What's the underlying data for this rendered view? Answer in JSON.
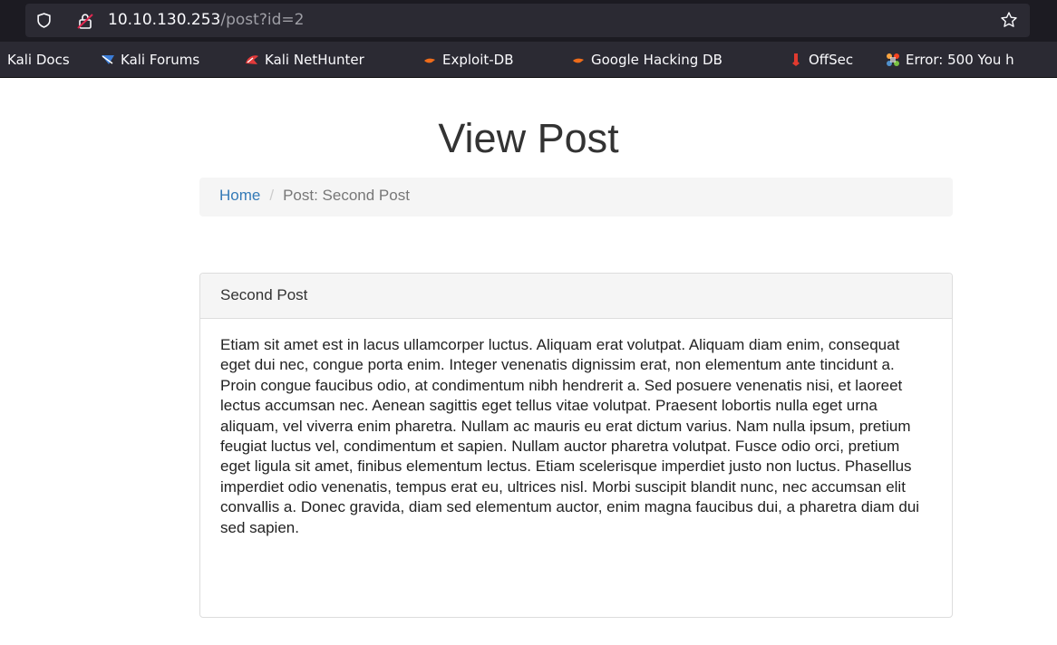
{
  "browser": {
    "url_host": "10.10.130.253",
    "url_path": "/post?id=2",
    "bookmarks": [
      {
        "label": "Kali Docs",
        "icon": "kali-docs-icon"
      },
      {
        "label": "Kali Forums",
        "icon": "kali-forums-icon"
      },
      {
        "label": "Kali NetHunter",
        "icon": "kali-nethunter-icon"
      },
      {
        "label": "Exploit-DB",
        "icon": "exploit-db-icon"
      },
      {
        "label": "Google Hacking DB",
        "icon": "google-hacking-db-icon"
      },
      {
        "label": "OffSec",
        "icon": "offsec-icon"
      },
      {
        "label": "Error: 500 You h",
        "icon": "joomla-icon"
      }
    ]
  },
  "page": {
    "title": "View Post",
    "breadcrumb": {
      "home": "Home",
      "current": "Post: Second Post"
    },
    "post": {
      "title": "Second Post",
      "body": "Etiam sit amet est in lacus ullamcorper luctus. Aliquam erat volutpat. Aliquam diam enim, consequat eget dui nec, congue porta enim. Integer venenatis dignissim erat, non elementum ante tincidunt a. Proin congue faucibus odio, at condimentum nibh hendrerit a. Sed posuere venenatis nisi, et laoreet lectus accumsan nec. Aenean sagittis eget tellus vitae volutpat. Praesent lobortis nulla eget urna aliquam, vel viverra enim pharetra. Nullam ac mauris eu erat dictum varius. Nam nulla ipsum, pretium feugiat luctus vel, condimentum et sapien. Nullam auctor pharetra volutpat. Fusce odio orci, pretium eget ligula sit amet, finibus elementum lectus. Etiam scelerisque imperdiet justo non luctus. Phasellus imperdiet odio venenatis, tempus erat eu, ultrices nisl. Morbi suscipit blandit nunc, nec accumsan elit convallis a. Donec gravida, diam sed elementum auctor, enim magna faucibus dui, a pharetra diam dui sed sapien."
    }
  },
  "colors": {
    "link": "#337ab7",
    "chrome_dark": "#1c1b22",
    "chrome_bar": "#2b2a33"
  }
}
